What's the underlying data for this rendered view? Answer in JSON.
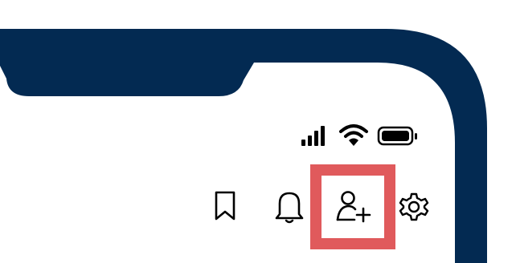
{
  "device": {
    "frame_color": "#032a52",
    "status_icons": [
      "cellular-signal-icon",
      "wifi-icon",
      "battery-icon"
    ]
  },
  "toolbar": {
    "icons": [
      "bookmark-icon",
      "bell-icon",
      "add-user-icon",
      "gear-icon"
    ],
    "highlighted": "add-user-icon",
    "highlight_color": "#e05a5c"
  }
}
